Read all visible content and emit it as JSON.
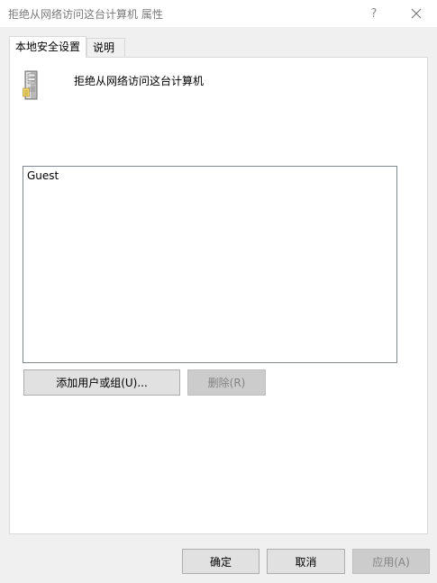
{
  "window": {
    "title": "拒绝从网络访问这台计算机 属性",
    "help_label": "?",
    "close_icon": "close-icon"
  },
  "tabs": [
    {
      "label": "本地安全设置",
      "active": true
    },
    {
      "label": "说明",
      "active": false
    }
  ],
  "policy": {
    "name": "拒绝从网络访问这台计算机",
    "icon": "server-icon"
  },
  "members": [
    "Guest"
  ],
  "actions": {
    "add_label": "添加用户或组(U)...",
    "remove_label": "删除(R)"
  },
  "footer": {
    "ok_label": "确定",
    "cancel_label": "取消",
    "apply_label": "应用(A)"
  },
  "colors": {
    "window_bg": "#f0f0f0",
    "page_bg": "#ffffff",
    "button_bg": "#e1e1e1",
    "button_disabled_bg": "#cccccc",
    "disabled_text": "#838383"
  }
}
